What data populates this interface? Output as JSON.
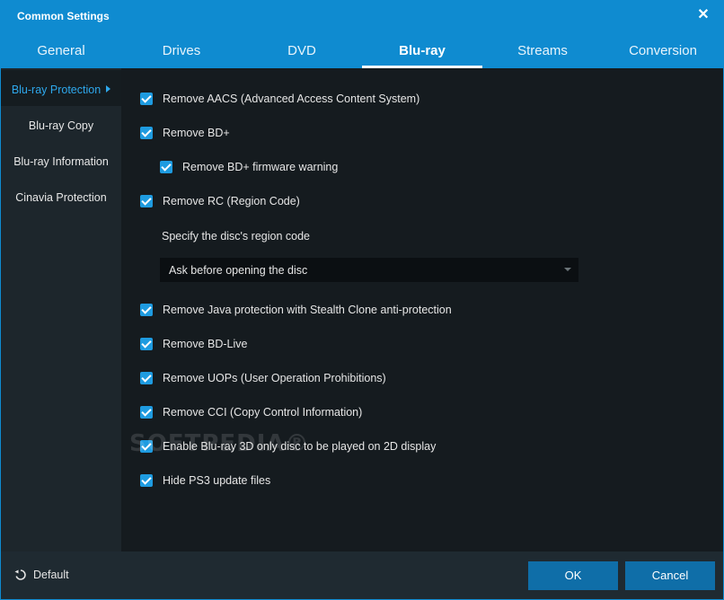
{
  "window": {
    "title": "Common Settings",
    "close_glyph": "✕"
  },
  "tabs": [
    {
      "label": "General",
      "active": false
    },
    {
      "label": "Drives",
      "active": false
    },
    {
      "label": "DVD",
      "active": false
    },
    {
      "label": "Blu-ray",
      "active": true
    },
    {
      "label": "Streams",
      "active": false
    },
    {
      "label": "Conversion",
      "active": false
    }
  ],
  "sidebar": {
    "items": [
      {
        "label": "Blu-ray Protection",
        "active": true
      },
      {
        "label": "Blu-ray Copy",
        "active": false
      },
      {
        "label": "Blu-ray Information",
        "active": false
      },
      {
        "label": "Cinavia Protection",
        "active": false
      }
    ]
  },
  "options": [
    {
      "label": "Remove AACS (Advanced Access Content System)",
      "checked": true
    },
    {
      "label": "Remove BD+",
      "checked": true
    },
    {
      "label": "Remove BD+ firmware warning",
      "checked": true
    },
    {
      "label": "Remove RC (Region Code)",
      "checked": true
    },
    {
      "label": "Remove Java protection with Stealth Clone anti-protection",
      "checked": true
    },
    {
      "label": "Remove BD-Live",
      "checked": true
    },
    {
      "label": "Remove UOPs (User Operation Prohibitions)",
      "checked": true
    },
    {
      "label": "Remove CCI (Copy Control Information)",
      "checked": true
    },
    {
      "label": "Enable Blu-ray 3D only disc to be played on 2D display",
      "checked": true
    },
    {
      "label": "Hide PS3 update files",
      "checked": true
    }
  ],
  "region": {
    "label": "Specify the disc's region code",
    "selected": "Ask before opening the disc"
  },
  "footer": {
    "default_label": "Default",
    "ok_label": "OK",
    "cancel_label": "Cancel"
  },
  "watermark": "SOFTPEDIA®",
  "colors": {
    "accent": "#0f8bd0",
    "checkbox": "#1e9be0",
    "active_sidebar_text": "#2ea8ec",
    "button": "#0f6ea8"
  }
}
